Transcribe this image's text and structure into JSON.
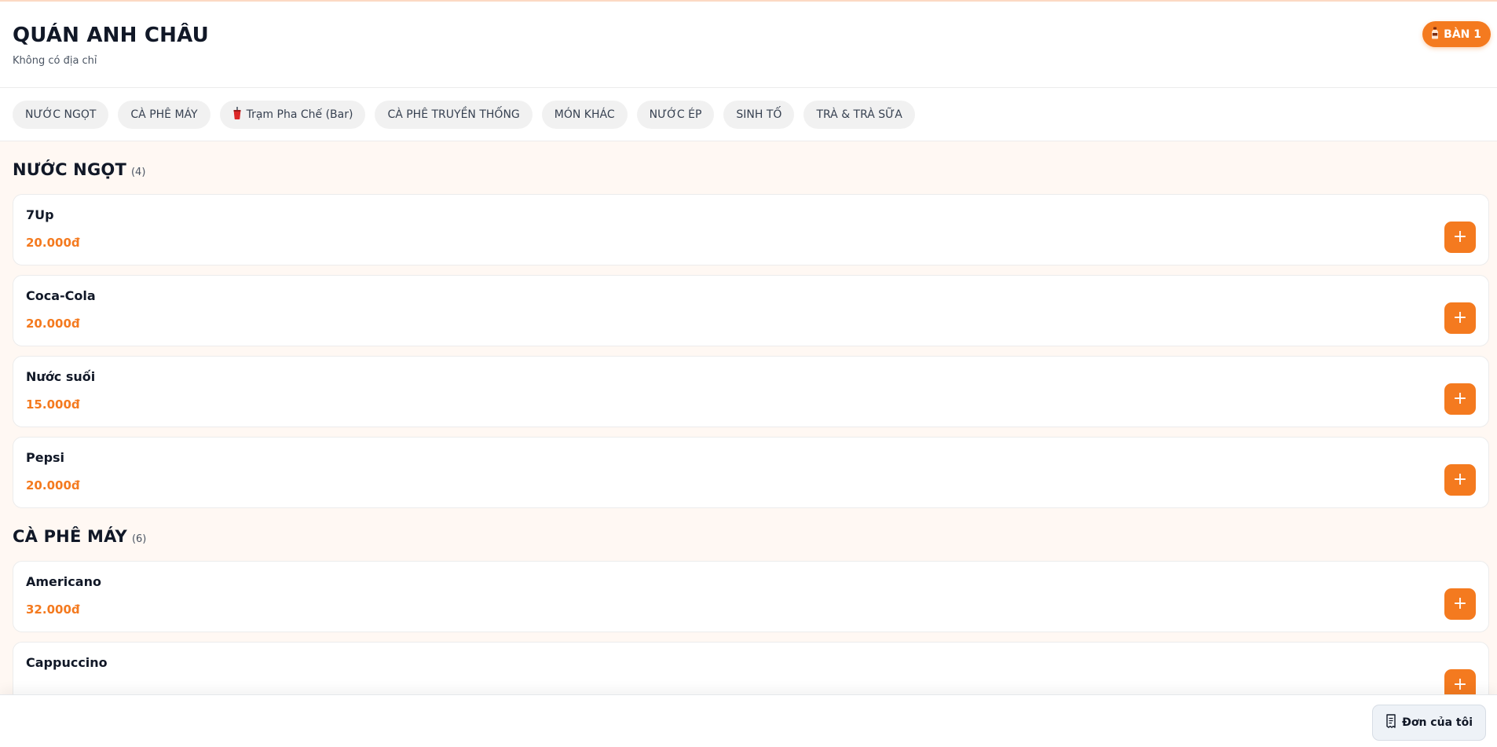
{
  "store": {
    "name": "QUÁN ANH CHÂU",
    "address": "Không có địa chỉ",
    "table_label": "BÀN 1"
  },
  "colors": {
    "accent": "#f47a1f",
    "chip_bg": "#f1f1f1",
    "page_bg": "#fff8f3"
  },
  "categories": [
    {
      "label": "NƯỚC NGỌT"
    },
    {
      "label": "CÀ PHÊ MÁY"
    },
    {
      "label": "Trạm Pha Chế (Bar)",
      "icon": "cup-icon"
    },
    {
      "label": "CÀ PHÊ TRUYỀN THỐNG"
    },
    {
      "label": "MÓN KHÁC"
    },
    {
      "label": "NƯỚC ÉP"
    },
    {
      "label": "SINH TỐ"
    },
    {
      "label": "TRÀ & TRÀ SỮA"
    }
  ],
  "sections": [
    {
      "name": "NƯỚC NGỌT",
      "count": "(4)",
      "items": [
        {
          "name": "7Up",
          "price": "20.000đ"
        },
        {
          "name": "Coca-Cola",
          "price": "20.000đ"
        },
        {
          "name": "Nước suối",
          "price": "15.000đ"
        },
        {
          "name": "Pepsi",
          "price": "20.000đ"
        }
      ]
    },
    {
      "name": "CÀ PHÊ MÁY",
      "count": "(6)",
      "items": [
        {
          "name": "Americano",
          "price": "32.000đ"
        },
        {
          "name": "Cappuccino",
          "price": ""
        }
      ]
    }
  ],
  "add_label": "+",
  "footer": {
    "my_order_label": "Đơn của tôi",
    "icon": "receipt-icon"
  }
}
